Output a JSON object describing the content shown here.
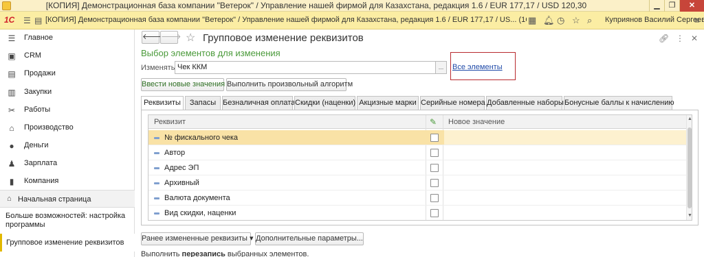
{
  "window": {
    "title": "[КОПИЯ] Демонстрационная база компании \"Ветерок\" / Управление нашей фирмой для Казахстана, редакция 1.6 / EUR 177,17 / USD 120,30",
    "minimize": "▁",
    "maximize": "❐",
    "close": "✕"
  },
  "appbar": {
    "logo": "1С",
    "title": "[КОПИЯ] Демонстрационная база компании \"Ветерок\" / Управление нашей фирмой для Казахстана, редакция 1.6 / EUR 177,17 / US...  (1С:Предприятие)",
    "user": "Куприянов Василий Сергеевич"
  },
  "sidebar": {
    "items": [
      {
        "label": "Главное",
        "icon": "menu-lines-icon"
      },
      {
        "label": "CRM",
        "icon": "crm-icon"
      },
      {
        "label": "Продажи",
        "icon": "sales-icon"
      },
      {
        "label": "Закупки",
        "icon": "purchases-icon"
      },
      {
        "label": "Работы",
        "icon": "tools-icon"
      },
      {
        "label": "Производство",
        "icon": "factory-icon"
      },
      {
        "label": "Деньги",
        "icon": "money-icon"
      },
      {
        "label": "Зарплата",
        "icon": "salary-icon"
      },
      {
        "label": "Компания",
        "icon": "company-icon"
      }
    ],
    "home": "Начальная страница",
    "more": "Больше возможностей: настройка программы",
    "open_form": "Групповое изменение реквизитов"
  },
  "form": {
    "title": "Групповое изменение реквизитов",
    "section_title": "Выбор элементов для изменения",
    "change_label": "Изменять:",
    "change_value": "Чек ККМ",
    "dots": "...",
    "all_elements_link": "Все элементы",
    "mode_buttons": [
      "Ввести новые значения",
      "Выполнить произвольный алгоритм"
    ],
    "tabs": [
      "Реквизиты",
      "Запасы",
      "Безналичная оплата",
      "Скидки (наценки)",
      "Акцизные марки",
      "Серийные номера",
      "Добавленные наборы",
      "Бонусные баллы к начислению"
    ],
    "grid": {
      "col_attribute": "Реквизит",
      "col_new_value": "Новое значение",
      "rows": [
        {
          "name": "№ фискального чека",
          "selected": true
        },
        {
          "name": "Автор",
          "selected": false
        },
        {
          "name": "Адрес ЭП",
          "selected": false
        },
        {
          "name": "Архивный",
          "selected": false
        },
        {
          "name": "Валюта документа",
          "selected": false
        },
        {
          "name": "Вид скидки, наценки",
          "selected": false
        }
      ]
    },
    "bottom_buttons": [
      "Ранее измененные реквизиты ▾",
      "Дополнительные параметры..."
    ],
    "footer_prefix": "Выполнить ",
    "footer_bold": "перезапись",
    "footer_suffix": " выбранных элементов."
  },
  "colors": {
    "accent_green": "#4a9a3a",
    "appbar_yellow": "#fbeda3",
    "selection": "#f9e2a6",
    "highlight_box": "#b8292d",
    "link": "#1f4aa8"
  }
}
